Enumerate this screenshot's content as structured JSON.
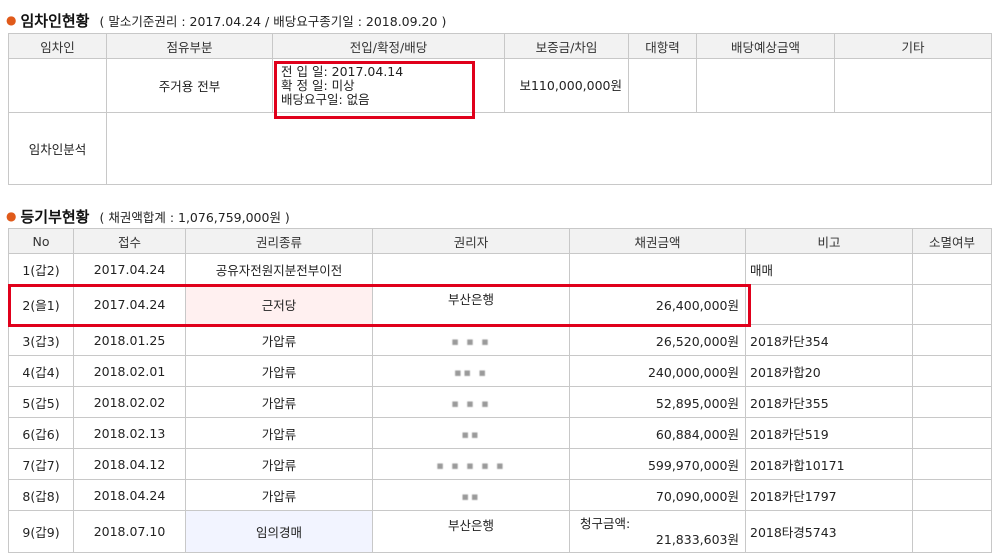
{
  "tenant_section": {
    "title": "임차인현황",
    "subtitle": "( 말소기준권리 : 2017.04.24 / 배당요구종기일 : 2018.09.20 )",
    "headers": [
      "임차인",
      "점유부분",
      "전입/확정/배당",
      "보증금/차임",
      "대항력",
      "배당예상금액",
      "기타"
    ],
    "row": {
      "tenant": "",
      "occupancy": "주거용 전부",
      "movein_line": "전 입 일: 2017.04.14",
      "fixed_line": "확 정 일: 미상",
      "dividend_line": "배당요구일: 없음",
      "deposit": "보110,000,000원",
      "opposing": "",
      "expected": "",
      "etc": ""
    },
    "analysis_label": "임차인분석",
    "analysis_value": ""
  },
  "registry_section": {
    "title": "등기부현황",
    "subtitle": "( 채권액합계 : 1,076,759,000원 )",
    "headers": [
      "No",
      "접수",
      "권리종류",
      "권리자",
      "채권금액",
      "비고",
      "소멸여부"
    ],
    "rows": [
      {
        "no": "1(갑2)",
        "date": "2017.04.24",
        "type": "공유자전원지분전부이전",
        "holder": "",
        "amount": "",
        "note": "매매",
        "ext": ""
      },
      {
        "no": "2(을1)",
        "date": "2017.04.24",
        "type": "근저당",
        "holder": "부산은행",
        "amount": "26,400,000원",
        "note": "",
        "ext": ""
      },
      {
        "no": "3(갑3)",
        "date": "2018.01.25",
        "type": "가압류",
        "holder": "▪ ▪ ▪",
        "amount": "26,520,000원",
        "note": "2018카단354",
        "ext": ""
      },
      {
        "no": "4(갑4)",
        "date": "2018.02.01",
        "type": "가압류",
        "holder": "▪▪ ▪",
        "amount": "240,000,000원",
        "note": "2018카합20",
        "ext": ""
      },
      {
        "no": "5(갑5)",
        "date": "2018.02.02",
        "type": "가압류",
        "holder": "▪ ▪ ▪",
        "amount": "52,895,000원",
        "note": "2018카단355",
        "ext": ""
      },
      {
        "no": "6(갑6)",
        "date": "2018.02.13",
        "type": "가압류",
        "holder": "▪▪",
        "amount": "60,884,000원",
        "note": "2018카단519",
        "ext": ""
      },
      {
        "no": "7(갑7)",
        "date": "2018.04.12",
        "type": "가압류",
        "holder": "▪ ▪ ▪ ▪ ▪",
        "amount": "599,970,000원",
        "note": "2018카합10171",
        "ext": ""
      },
      {
        "no": "8(갑8)",
        "date": "2018.04.24",
        "type": "가압류",
        "holder": "▪▪",
        "amount": "70,090,000원",
        "note": "2018카단1797",
        "ext": ""
      },
      {
        "no": "9(갑9)",
        "date": "2018.07.10",
        "type": "임의경매",
        "holder": "부산은행",
        "amount_label": "청구금액:",
        "amount": "21,833,603원",
        "note": "2018타경5743",
        "ext": ""
      }
    ]
  },
  "colors": {
    "bullet": "#e05a1a",
    "highlight_box": "#e0001b",
    "header_bg": "#f2f2f2"
  }
}
